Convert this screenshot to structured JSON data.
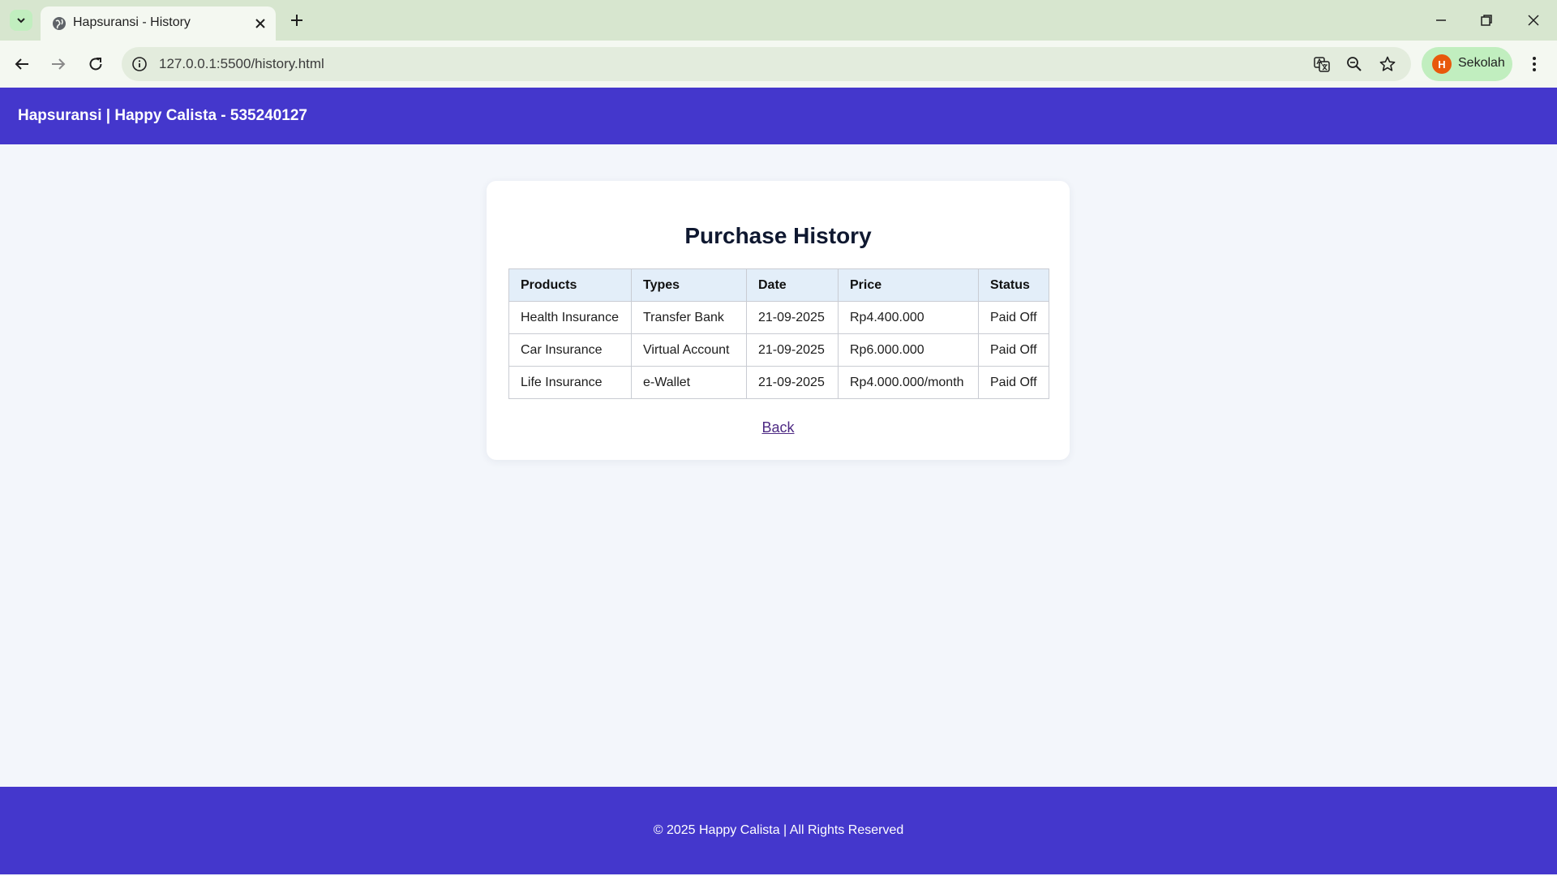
{
  "browser": {
    "tab_title": "Hapsuransi - History",
    "url": "127.0.0.1:5500/history.html",
    "profile_initial": "H",
    "profile_name": "Sekolah",
    "profile_color": "#e8590c"
  },
  "header": {
    "title": "Hapsuransi | Happy Calista - 535240127",
    "background": "#4437cc"
  },
  "main": {
    "title": "Purchase History",
    "table": {
      "columns": [
        "Products",
        "Types",
        "Date",
        "Price",
        "Status"
      ],
      "rows": [
        [
          "Health Insurance",
          "Transfer Bank",
          "21-09-2025",
          "Rp4.400.000",
          "Paid Off"
        ],
        [
          "Car Insurance",
          "Virtual Account",
          "21-09-2025",
          "Rp6.000.000",
          "Paid Off"
        ],
        [
          "Life Insurance",
          "e-Wallet",
          "21-09-2025",
          "Rp4.000.000/month",
          "Paid Off"
        ]
      ]
    },
    "back_label": "Back"
  },
  "footer": {
    "text": "© 2025 Happy Calista | All Rights Reserved"
  },
  "icons": {
    "tab_search": "chevron-down-icon",
    "favicon": "globe-icon",
    "close_tab": "close-icon",
    "new_tab": "plus-icon",
    "back": "arrow-left-icon",
    "forward": "arrow-right-icon",
    "reload": "reload-icon",
    "site_info": "info-icon",
    "translate": "translate-icon",
    "zoom": "zoom-out-icon",
    "bookmark": "star-icon",
    "menu": "more-vertical-icon",
    "minimize": "minimize-icon",
    "restore": "restore-icon",
    "close_window": "close-icon"
  }
}
